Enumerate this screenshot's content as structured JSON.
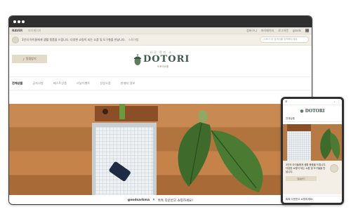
{
  "desktop": {
    "topbar": {
      "brand": "NAVER",
      "util_link": "마이페이지",
      "right_links": [
        "장바구니",
        "마이페이지",
        "로그아웃",
        "goods"
      ]
    },
    "notice": {
      "text": "3인의 아이들에게 생활 용품을 드립니다. 다양한 쇼핑이 되는 소품 및 도구들을 만납니다.",
      "link": "스토어찜",
      "search_placeholder": "스토어 내 검색어를 입력해주세요"
    },
    "header": {
      "subscribe_label": "알림받기",
      "logo_top": "나무 작가 소",
      "logo_name": "DOTORI",
      "logo_sub": "도토리소품"
    },
    "nav": {
      "items": [
        "전체상품",
        "공지사항",
        "베스트상품",
        "리뷰이벤트",
        "신상소품",
        "판매자 정보"
      ]
    },
    "footer": {
      "brand": "goodsarkma",
      "text": "톡톡 다운받고 쇼핑하세요!"
    }
  },
  "mobile": {
    "logo_name": "DOTORI",
    "tab": "전체상품",
    "card_text": "3인의 아이들에게 생활 용품을 드립니다. 다양한 쇼핑이 되는 소품 및 도구들을 만납니다.",
    "card_button": "알림받기",
    "bottom_text": "톡톡 다운받고 쇼핑하세요!"
  },
  "colors": {
    "chrome": "#2f2f2f",
    "accent_green": "#3c5a4a",
    "beige": "#e3dbc8",
    "wood": "#b77a44"
  }
}
